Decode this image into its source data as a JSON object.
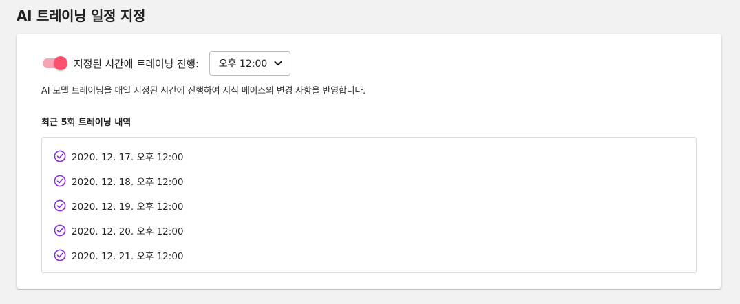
{
  "page": {
    "title": "AI 트레이닝 일정 지정"
  },
  "schedule": {
    "toggle_on": true,
    "toggle_label": "지정된 시간에 트레이닝 진행:",
    "selected_time": "오후 12:00",
    "description": "AI 모델 트레이닝을 매일 지정된 시간에 진행하여 지식 베이스의 변경 사항을 반영합니다."
  },
  "history": {
    "title": "최근 5회 트레이닝 내역",
    "items": [
      "2020. 12. 17. 오후 12:00",
      "2020. 12. 18. 오후 12:00",
      "2020. 12. 19. 오후 12:00",
      "2020. 12. 20. 오후 12:00",
      "2020. 12. 21. 오후 12:00"
    ]
  },
  "icons": {
    "check": "check-circle-icon",
    "chevron": "chevron-down-icon"
  },
  "colors": {
    "toggle_thumb": "#ff4f6f",
    "toggle_track": "#f7a4b5",
    "check_icon": "#8a2be2"
  }
}
